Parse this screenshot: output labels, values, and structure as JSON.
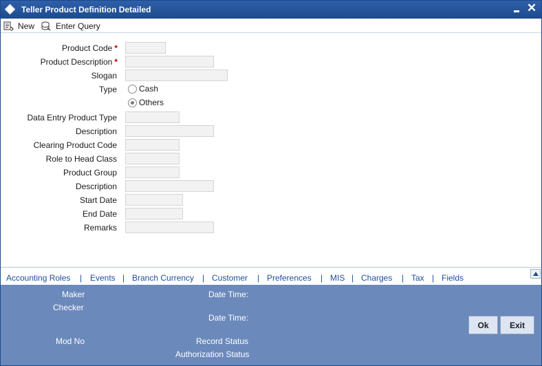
{
  "window": {
    "title": "Teller Product Definition Detailed",
    "close_glyph": "✕"
  },
  "toolbar": {
    "new_label": "New",
    "enter_query_label": "Enter Query"
  },
  "form": {
    "product_code_label": "Product Code",
    "product_description_label": "Product Description",
    "slogan_label": "Slogan",
    "type_label": "Type",
    "type_options": [
      "Cash",
      "Others"
    ],
    "type_selected": "Others",
    "data_entry_product_type_label": "Data Entry Product Type",
    "description_label_1": "Description",
    "clearing_product_code_label": "Clearing Product Code",
    "role_to_head_class_label": "Role to Head Class",
    "product_group_label": "Product Group",
    "description_label_2": "Description",
    "start_date_label": "Start Date",
    "end_date_label": "End Date",
    "remarks_label": "Remarks",
    "required_marker": "*",
    "product_code_value": "",
    "product_description_value": "",
    "slogan_value": "",
    "data_entry_product_type_value": "",
    "description_value_1": "",
    "clearing_product_code_value": "",
    "role_to_head_class_value": "",
    "product_group_value": "",
    "description_value_2": "",
    "start_date_value": "",
    "end_date_value": "",
    "remarks_value": ""
  },
  "tabs": [
    "Accounting Roles",
    "Events",
    "Branch Currency",
    "Customer",
    "Preferences",
    "MIS",
    "Charges",
    "Tax",
    "Fields"
  ],
  "tab_separator": "|",
  "footer": {
    "maker_label": "Maker",
    "checker_label": "Checker",
    "date_time_label_1": "Date Time:",
    "date_time_label_2": "Date Time:",
    "mod_no_label": "Mod No",
    "record_status_label": "Record Status",
    "authorization_status_label": "Authorization Status",
    "ok_label": "Ok",
    "exit_label": "Exit"
  },
  "colors": {
    "title_bar": "#1d4b8f",
    "footer": "#6b89bb",
    "tab_link": "#1f4e9a",
    "required": "#c00000"
  }
}
